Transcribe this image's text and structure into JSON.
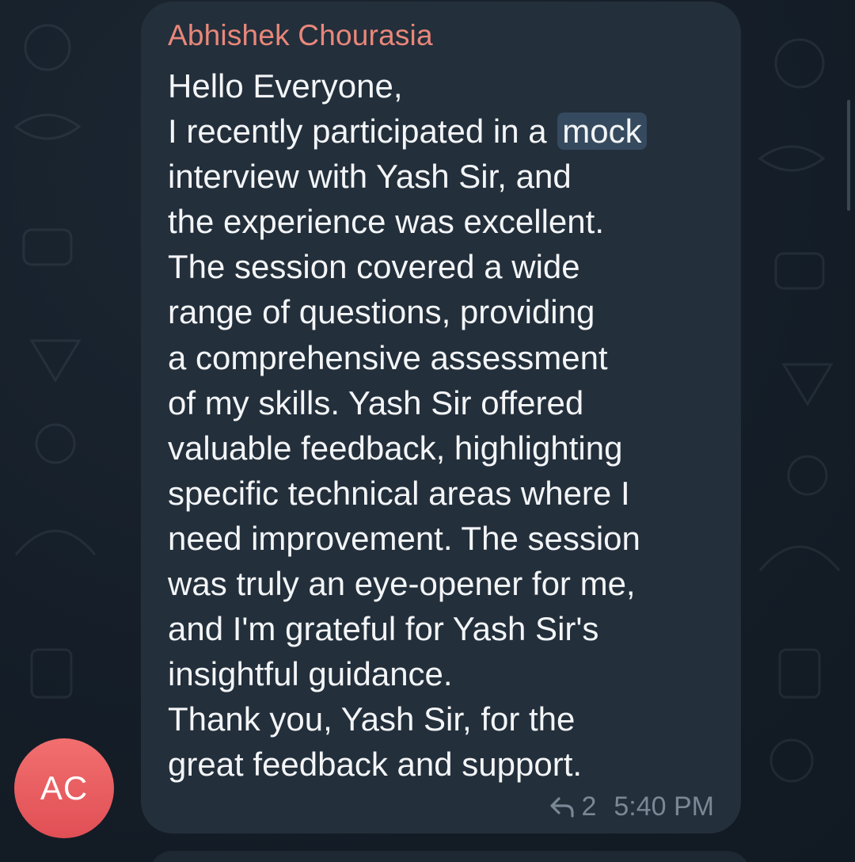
{
  "message": {
    "sender_name": "Abhishek Chourasia",
    "lines": [
      {
        "before": "Hello Everyone,",
        "highlight": ""
      },
      {
        "before": "I recently participated in a ",
        "highlight": "mock"
      },
      {
        "before": "interview with Yash Sir, and",
        "highlight": ""
      },
      {
        "before": "the experience was excellent.",
        "highlight": ""
      },
      {
        "before": "The session covered a wide",
        "highlight": ""
      },
      {
        "before": "range of questions, providing",
        "highlight": ""
      },
      {
        "before": "a comprehensive assessment",
        "highlight": ""
      },
      {
        "before": "of my skills. Yash Sir offered",
        "highlight": ""
      },
      {
        "before": "valuable feedback, highlighting",
        "highlight": ""
      },
      {
        "before": "specific technical areas where I",
        "highlight": ""
      },
      {
        "before": "need improvement. The session",
        "highlight": ""
      },
      {
        "before": "was truly an eye-opener for me,",
        "highlight": ""
      },
      {
        "before": "and I'm grateful for Yash Sir's",
        "highlight": ""
      },
      {
        "before": "insightful guidance.",
        "highlight": ""
      },
      {
        "before": "Thank you, Yash Sir, for the",
        "highlight": ""
      },
      {
        "before": "great feedback and support.",
        "highlight": ""
      }
    ],
    "reply_count": "2",
    "time": "5:40 PM"
  },
  "avatar": {
    "initials": "AC"
  },
  "icons": {
    "reply": "reply-arrow-icon"
  },
  "colors": {
    "background": "#141d27",
    "bubble": "#232f3b",
    "sender_name": "#e9877a",
    "message_text": "#f3f5f7",
    "search_highlight": "#354a5e",
    "meta_text": "#7a8896",
    "avatar": "#e95a5e"
  }
}
